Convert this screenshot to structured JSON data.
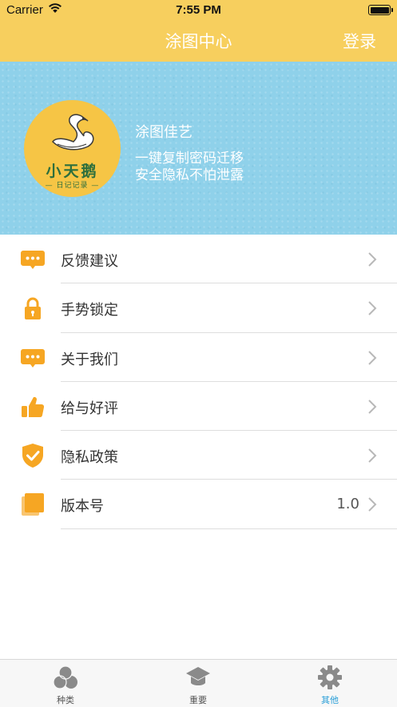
{
  "status_bar": {
    "carrier": "Carrier",
    "time": "7:55 PM"
  },
  "nav": {
    "title": "涂图中心",
    "login_label": "登录"
  },
  "banner": {
    "logo_title": "小天鹅",
    "logo_subtitle": "— 日记记录 —",
    "app_name": "涂图佳艺",
    "desc_line1": "一键复制密码迁移",
    "desc_line2": "安全隐私不怕泄露"
  },
  "menu": [
    {
      "label": "反馈建议",
      "icon": "chat-bubble-icon"
    },
    {
      "label": " 手势锁定",
      "icon": "lock-icon"
    },
    {
      "label": "关于我们",
      "icon": "chat-bubble-icon"
    },
    {
      "label": "给与好评",
      "icon": "thumbs-up-icon"
    },
    {
      "label": "隐私政策",
      "icon": "shield-check-icon"
    },
    {
      "label": "版本号",
      "icon": "layers-icon",
      "value": "1.0"
    }
  ],
  "tabs": [
    {
      "label": "种类",
      "icon": "circles-icon",
      "active": false
    },
    {
      "label": "重要",
      "icon": "graduation-cap-icon",
      "active": false
    },
    {
      "label": "其他",
      "icon": "gear-icon",
      "active": true
    }
  ],
  "colors": {
    "accent": "#f7cf5e",
    "banner": "#8fd1ea",
    "icon_orange": "#f6a623",
    "active_tab": "#2a9fd8"
  }
}
